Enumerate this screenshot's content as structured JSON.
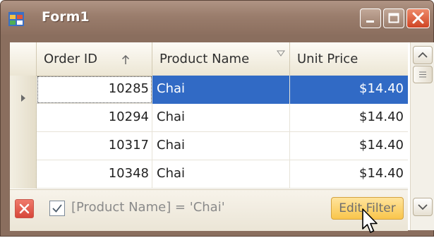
{
  "window": {
    "title": "Form1",
    "icon": "form-app-icon"
  },
  "caption_buttons": {
    "minimize": "minimize-icon",
    "maximize": "maximize-icon",
    "close": "close-icon"
  },
  "grid": {
    "columns": [
      {
        "label": "Order ID",
        "sort": "ascending"
      },
      {
        "label": "Product Name",
        "filter_active": true
      },
      {
        "label": "Unit Price"
      }
    ],
    "rows": [
      {
        "order_id": "10285",
        "product_name": "Chai",
        "unit_price": "$14.40",
        "selected": true
      },
      {
        "order_id": "10294",
        "product_name": "Chai",
        "unit_price": "$14.40"
      },
      {
        "order_id": "10317",
        "product_name": "Chai",
        "unit_price": "$14.40"
      },
      {
        "order_id": "10348",
        "product_name": "Chai",
        "unit_price": "$14.40"
      }
    ]
  },
  "filter_panel": {
    "expression": "[Product Name] = 'Chai'",
    "enabled": true,
    "edit_button": "Edit Filter"
  },
  "colors": {
    "selection": "#316ac5",
    "titlebar": "#9a7d6c",
    "edit_button": "#f9c54b",
    "close_red": "#d7473a"
  }
}
